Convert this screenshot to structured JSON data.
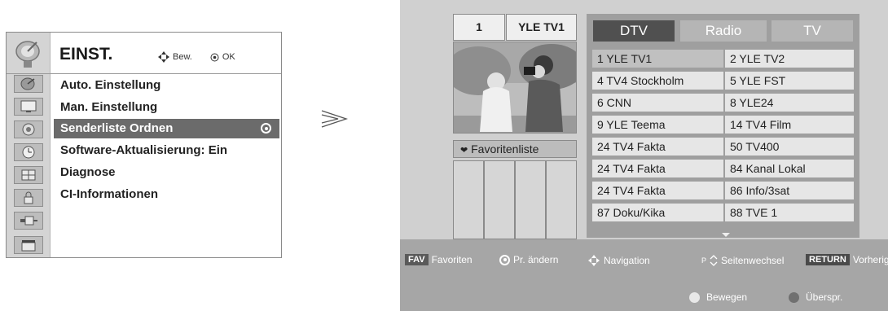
{
  "left_menu": {
    "title": "EINST.",
    "move_hint": "Bew.",
    "ok_hint": "OK",
    "items": [
      {
        "label": "Auto. Einstellung",
        "selected": false
      },
      {
        "label": "Man. Einstellung",
        "selected": false
      },
      {
        "label": "Senderliste Ordnen",
        "selected": true
      },
      {
        "label": "Software-Aktualisierung: Ein",
        "selected": false
      },
      {
        "label": "Diagnose",
        "selected": false
      },
      {
        "label": "CI-Informationen",
        "selected": false
      }
    ],
    "side_icons": [
      "satellite-dish-icon",
      "monitor-icon",
      "speaker-icon",
      "clock-icon",
      "grid-icon",
      "lock-icon",
      "plug-icon",
      "clapperboard-icon"
    ]
  },
  "transition_arrow": "≫",
  "channel_screen": {
    "program_number": "1",
    "program_name": "YLE TV1",
    "tabs": [
      {
        "label": "DTV",
        "active": true
      },
      {
        "label": "Radio",
        "active": false
      },
      {
        "label": "TV",
        "active": false
      }
    ],
    "channels": [
      [
        "1 YLE TV1",
        "2 YLE TV2"
      ],
      [
        "4 TV4 Stockholm",
        "5 YLE FST"
      ],
      [
        "6 CNN",
        "8 YLE24"
      ],
      [
        "9 YLE Teema",
        "14 TV4 Film"
      ],
      [
        "24 TV4 Fakta",
        "50 TV400"
      ],
      [
        "24 TV4 Fakta",
        "84 Kanal Lokal"
      ],
      [
        "24 TV4 Fakta",
        "86 Info/3sat"
      ],
      [
        "87 Doku/Kika",
        "88 TVE 1"
      ]
    ],
    "selected_channel": "1 YLE TV1",
    "favorites_label": "Favoritenliste",
    "favorites_heart": "❤",
    "footer": {
      "fav_key": "FAV",
      "fav_label": "Favoriten",
      "change_label": "Pr. ändern",
      "nav_label": "Navigation",
      "page_key": "P",
      "page_label": "Seitenwechsel",
      "return_key": "RETURN",
      "return_label": "Vorherig",
      "move_label": "Bewegen",
      "skip_label": "Überspr.",
      "move_color": "#e8e8e8",
      "skip_color": "#707070"
    }
  }
}
